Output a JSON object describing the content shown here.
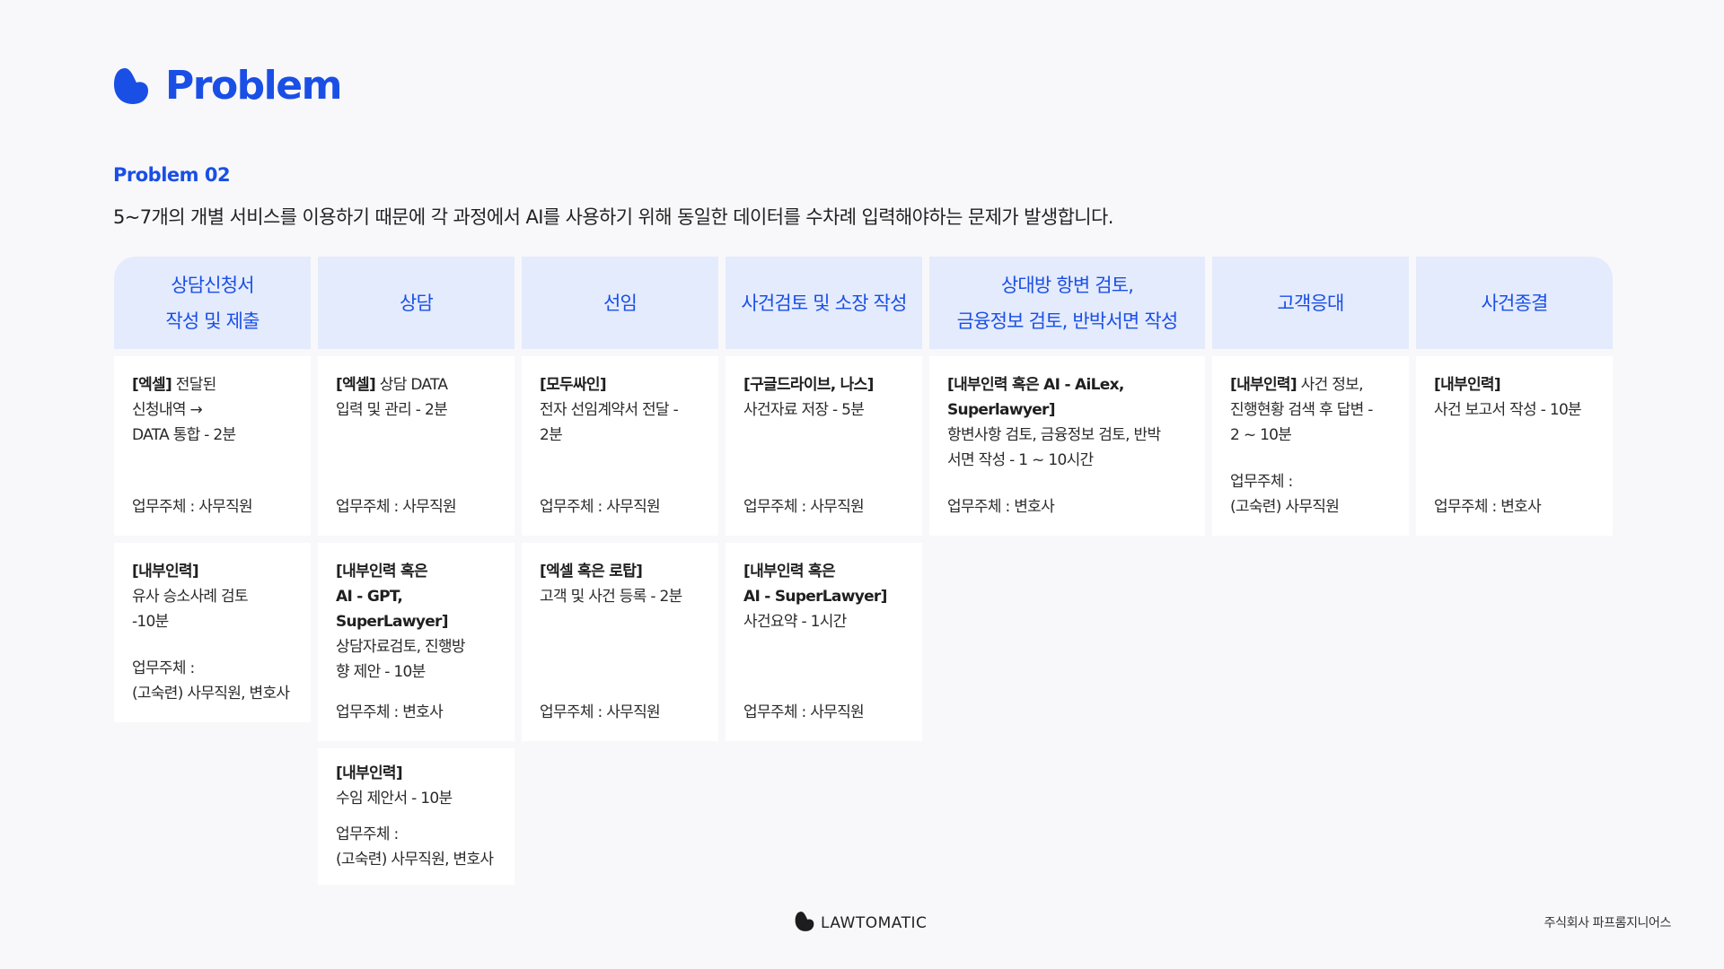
{
  "header": {
    "title": "Problem",
    "brand_color": "#1a4fe6"
  },
  "section": {
    "subtitle": "Problem 02",
    "description": "5~7개의 개별 서비스를 이용하기 때문에 각 과정에서 AI를 사용하기 위해 동일한 데이터를 수차례 입력해야하는 문제가 발생합니다."
  },
  "columns": [
    {
      "header": [
        "상담신청서",
        "작성 및 제출"
      ],
      "cards": [
        {
          "tool": "[엑셀]",
          "text": "전달된",
          "lines": [
            "신청내역 →",
            "DATA 통합 - 2분"
          ],
          "owner": [
            "업무주체 : 사무직원"
          ]
        },
        {
          "tool": "[내부인력]",
          "text": "",
          "lines": [
            "유사 승소사례 검토",
            "-10분"
          ],
          "owner": [
            "업무주체 :",
            "(고숙련) 사무직원, 변호사"
          ]
        }
      ]
    },
    {
      "header": [
        "상담"
      ],
      "cards": [
        {
          "tool": "[엑셀]",
          "text": "상담 DATA",
          "lines": [
            "입력 및 관리 - 2분"
          ],
          "owner": [
            "업무주체 : 사무직원"
          ]
        },
        {
          "tool": "[내부인력 혹은",
          "text": "",
          "tool_extra": [
            "AI - GPT,",
            "SuperLawyer]"
          ],
          "lines": [
            "상담자료검토, 진행방",
            "향 제안 - 10분"
          ],
          "owner": [
            "업무주체 : 변호사"
          ]
        },
        {
          "tool": "[내부인력]",
          "text": "",
          "lines": [
            "수임 제안서 - 10분"
          ],
          "owner": [
            "업무주체 :",
            "(고숙련) 사무직원, 변호사"
          ]
        }
      ]
    },
    {
      "header": [
        "선임"
      ],
      "cards": [
        {
          "tool": "[모두싸인]",
          "text": "",
          "lines": [
            "전자 선임계약서 전달 -",
            "2분"
          ],
          "owner": [
            "업무주체 : 사무직원"
          ]
        },
        {
          "tool": "[엑셀 혹은 로탑]",
          "text": "",
          "lines": [
            "고객 및 사건 등록 - 2분"
          ],
          "owner": [
            "업무주체 : 사무직원"
          ]
        }
      ]
    },
    {
      "header": [
        "사건검토 및 소장 작성"
      ],
      "cards": [
        {
          "tool": "[구글드라이브, 나스]",
          "text": "",
          "lines": [
            "사건자료 저장 - 5분"
          ],
          "owner": [
            "업무주체 : 사무직원"
          ]
        },
        {
          "tool": "[내부인력 혹은",
          "text": "",
          "tool_extra": [
            "AI - SuperLawyer]"
          ],
          "lines": [
            "사건요약 - 1시간"
          ],
          "owner": [
            "업무주체 : 사무직원"
          ]
        }
      ]
    },
    {
      "header": [
        "상대방 항변 검토,",
        "금융정보 검토, 반박서면 작성"
      ],
      "cards": [
        {
          "tool": "[내부인력 혹은 AI - AiLex,",
          "text": "",
          "tool_extra": [
            "Superlawyer]"
          ],
          "lines": [
            "항변사항 검토, 금융정보 검토, 반박",
            "서면 작성 - 1 ~ 10시간"
          ],
          "owner": [
            "업무주체 : 변호사"
          ]
        }
      ]
    },
    {
      "header": [
        "고객응대"
      ],
      "cards": [
        {
          "tool": "[내부인력]",
          "text": "사건 정보,",
          "lines": [
            "진행현황 검색 후 답변 -",
            "2 ~ 10분"
          ],
          "owner": [
            "업무주체 :",
            "(고숙련) 사무직원"
          ]
        }
      ]
    },
    {
      "header": [
        "사건종결"
      ],
      "cards": [
        {
          "tool": "[내부인력]",
          "text": "",
          "lines": [
            "사건 보고서 작성 - 10분"
          ],
          "owner": [
            "업무주체 : 변호사"
          ]
        }
      ]
    }
  ],
  "footer": {
    "brand": "LAWTOMATIC",
    "company": "주식회사 파프롬지니어스"
  }
}
